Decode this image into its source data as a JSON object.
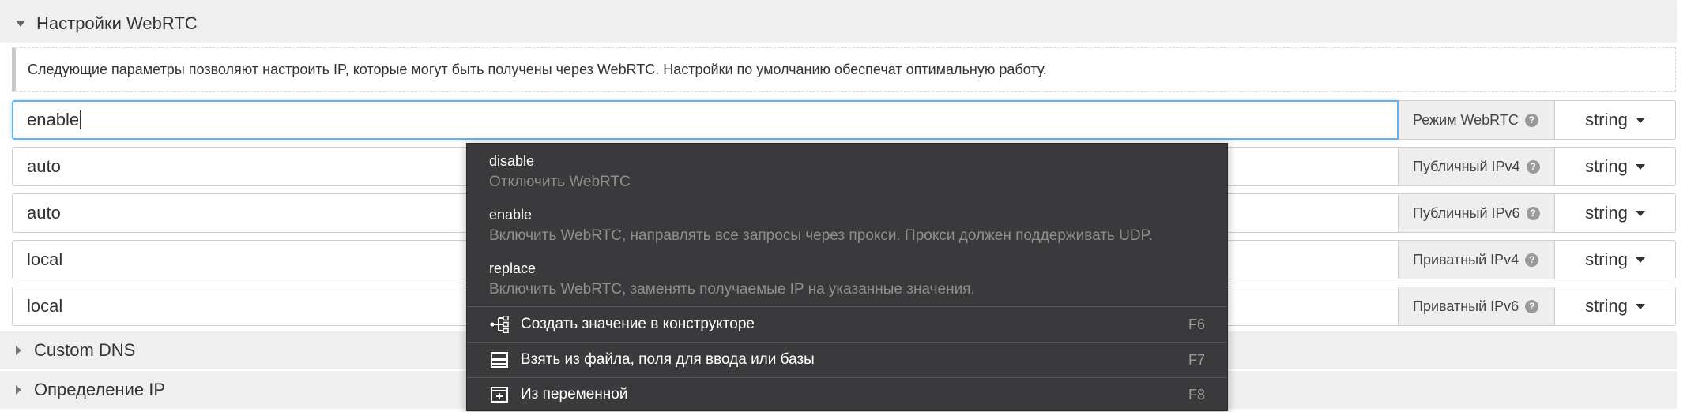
{
  "webrtc_section": {
    "title": "Настройки WebRTC",
    "info": "Следующие параметры позволяют настроить IP, которые могут быть получены через WebRTC. Настройки по умолчанию обеспечат оптимальную работу."
  },
  "rows": [
    {
      "value": "enable",
      "label": "Режим WebRTC",
      "type": "string"
    },
    {
      "value": "auto",
      "label": "Публичный IPv4",
      "type": "string"
    },
    {
      "value": "auto",
      "label": "Публичный IPv6",
      "type": "string"
    },
    {
      "value": "local",
      "label": "Приватный IPv4",
      "type": "string"
    },
    {
      "value": "local",
      "label": "Приватный IPv6",
      "type": "string"
    }
  ],
  "collapsed_sections": [
    {
      "title": "Custom DNS"
    },
    {
      "title": "Определение IP"
    }
  ],
  "help_glyph": "?",
  "dropdown": {
    "options": [
      {
        "name": "disable",
        "desc": "Отключить WebRTC"
      },
      {
        "name": "enable",
        "desc": "Включить WebRTC, направлять все запросы через прокси. Прокси должен поддерживать UDP."
      },
      {
        "name": "replace",
        "desc": "Включить WebRTC, заменять получаемые IP на указанные значения."
      }
    ],
    "actions": [
      {
        "label": "Создать значение в конструкторе",
        "key": "F6",
        "icon": "constructor-icon"
      },
      {
        "label": "Взять из файла, поля для ввода или базы",
        "key": "F7",
        "icon": "resource-icon"
      },
      {
        "label": "Из переменной",
        "key": "F8",
        "icon": "variable-icon"
      }
    ]
  },
  "colors": {
    "dropdown_bg": "#3a3a3c",
    "focus_border": "#66afe9",
    "section_bg": "#efefef"
  }
}
